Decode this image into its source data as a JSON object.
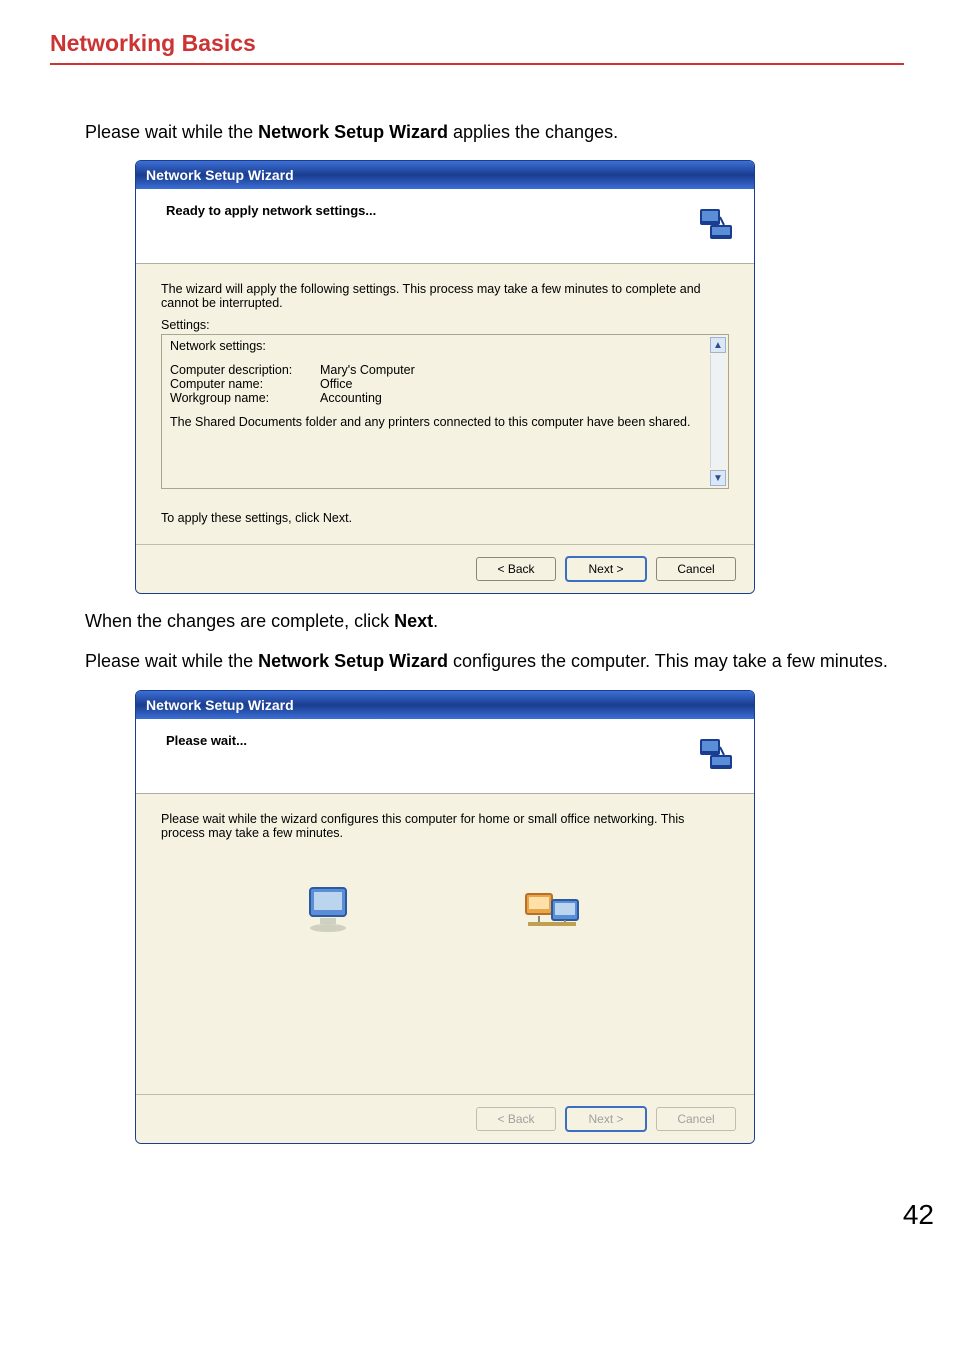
{
  "header": {
    "title": "Networking Basics"
  },
  "intro1": {
    "text_before": "Please wait while the ",
    "bold": "Network Setup Wizard",
    "text_after": " applies the changes."
  },
  "dialog1": {
    "title": "Network Setup Wizard",
    "header_title": "Ready to apply network settings...",
    "intro_line": "The wizard will apply the following settings. This process may take a few minutes to complete and cannot be interrupted.",
    "settings_label": "Settings:",
    "settings_top": "Network settings:",
    "kv": [
      {
        "k": "Computer description:",
        "v": "Mary's Computer"
      },
      {
        "k": "Computer name:",
        "v": "Office"
      },
      {
        "k": "Workgroup name:",
        "v": "Accounting"
      }
    ],
    "shared_text": "The Shared Documents folder and any printers connected to this computer have been shared.",
    "apply_text": "To apply these settings, click Next.",
    "buttons": {
      "back": "< Back",
      "next": "Next >",
      "cancel": "Cancel"
    }
  },
  "mid1": {
    "text_before": "When the changes are complete, click ",
    "bold": "Next",
    "text_after": "."
  },
  "mid2": {
    "text_before": "Please wait while the ",
    "bold": "Network Setup Wizard",
    "text_after": " configures the computer. This may take a few minutes."
  },
  "dialog2": {
    "title": "Network Setup Wizard",
    "header_title": "Please wait...",
    "body_text": "Please wait while the wizard configures this computer for home or small office networking. This process may take a few minutes.",
    "buttons": {
      "back": "< Back",
      "next": "Next >",
      "cancel": "Cancel"
    }
  },
  "page_number": "42"
}
